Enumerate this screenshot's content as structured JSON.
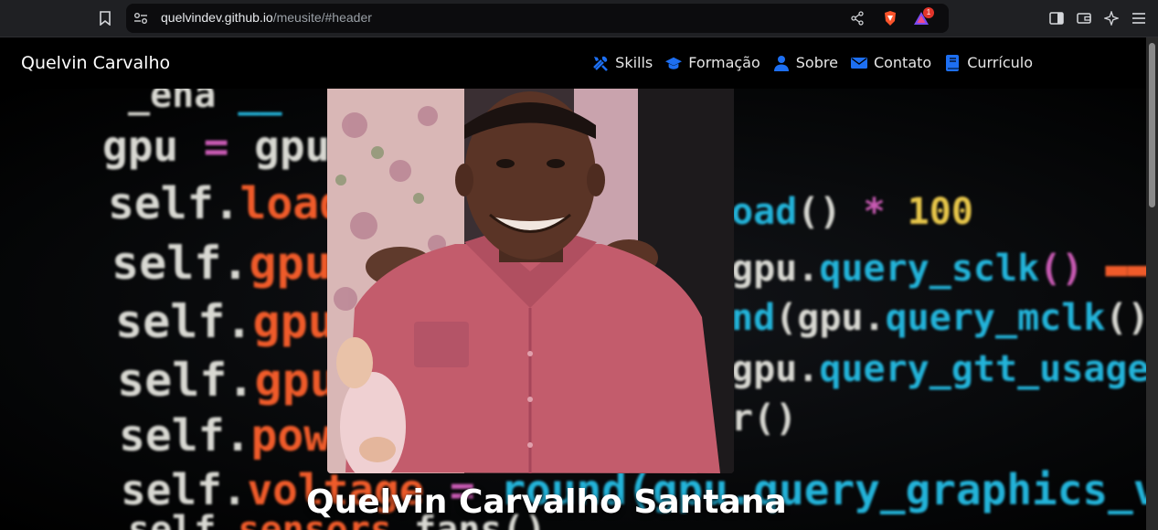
{
  "browser": {
    "url_host": "quelvindev.github.io",
    "url_path": "/meusite/#header",
    "notification_count": "1"
  },
  "navbar": {
    "brand": "Quelvin Carvalho",
    "items": [
      {
        "label": "Skills",
        "icon": "tools-icon"
      },
      {
        "label": "Formação",
        "icon": "graduation-cap-icon"
      },
      {
        "label": "Sobre",
        "icon": "user-icon"
      },
      {
        "label": "Contato",
        "icon": "envelope-icon"
      },
      {
        "label": "Currículo",
        "icon": "book-icon"
      }
    ],
    "accent_color": "#1d6ff2"
  },
  "hero": {
    "name": "Quelvin Carvalho Santana"
  }
}
